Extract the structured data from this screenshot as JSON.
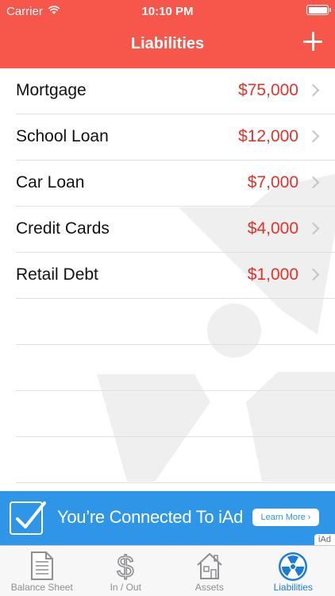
{
  "status_bar": {
    "carrier": "Carrier",
    "time": "10:10 PM"
  },
  "nav": {
    "title": "Liabilities",
    "add_icon": "plus-icon"
  },
  "liabilities": [
    {
      "label": "Mortgage",
      "value": "$75,000"
    },
    {
      "label": "School Loan",
      "value": "$12,000"
    },
    {
      "label": "Car Loan",
      "value": "$7,000"
    },
    {
      "label": "Credit Cards",
      "value": "$4,000"
    },
    {
      "label": "Retail Debt",
      "value": "$1,000"
    }
  ],
  "ad": {
    "text": "You’re Connected To iAd",
    "button": "Learn More ›",
    "tag": "iAd"
  },
  "tabs": [
    {
      "label": "Balance Sheet",
      "icon": "document-icon"
    },
    {
      "label": "In / Out",
      "icon": "dollar-icon"
    },
    {
      "label": "Assets",
      "icon": "house-icon"
    },
    {
      "label": "Liabilities",
      "icon": "radiation-icon",
      "active": true
    }
  ],
  "colors": {
    "header": "#f7574a",
    "value": "#e4322b",
    "ad": "#2f95e6",
    "active_tab": "#1a7bd8"
  }
}
